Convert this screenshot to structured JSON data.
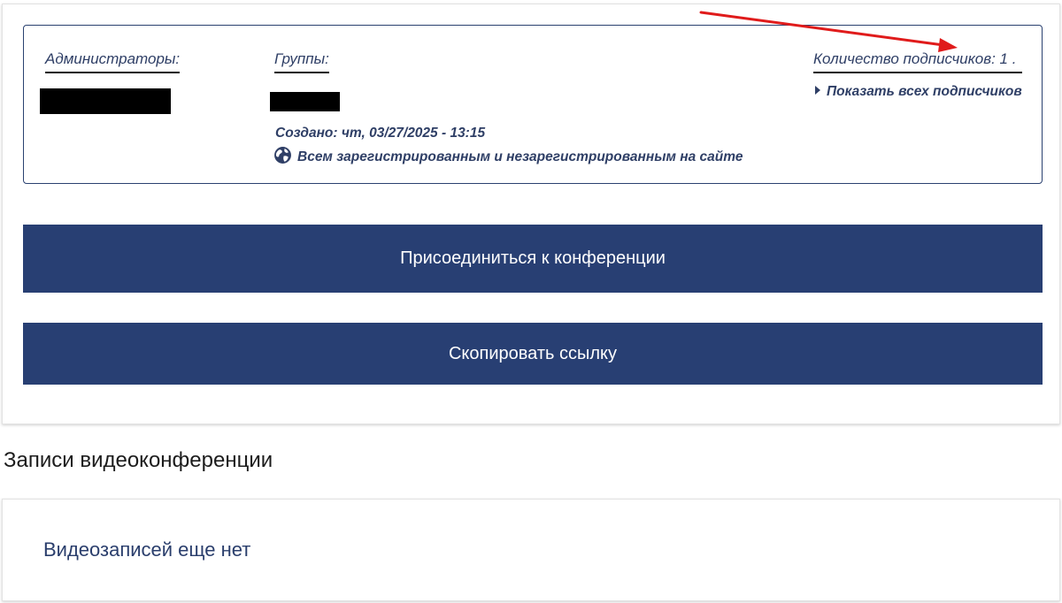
{
  "info": {
    "admins_label": "Администраторы:",
    "groups_label": "Группы:",
    "subscribers_label": "Количество подписчиков: 1 .",
    "show_all_link": "Показать всех подписчиков",
    "created": "Создано: чт, 03/27/2025 - 13:15",
    "visibility": "Всем зарегистрированным и незарегистрированным на сайте"
  },
  "actions": {
    "join_label": "Присоединиться к конференции",
    "copy_label": "Скопировать ссылку"
  },
  "recordings": {
    "title": "Записи видеоконференции",
    "empty_text": "Видеозаписей еще нет"
  },
  "colors": {
    "button_bg": "#283f73",
    "text_navy": "#2f3f66",
    "annotation_arrow": "#e01b1b"
  }
}
